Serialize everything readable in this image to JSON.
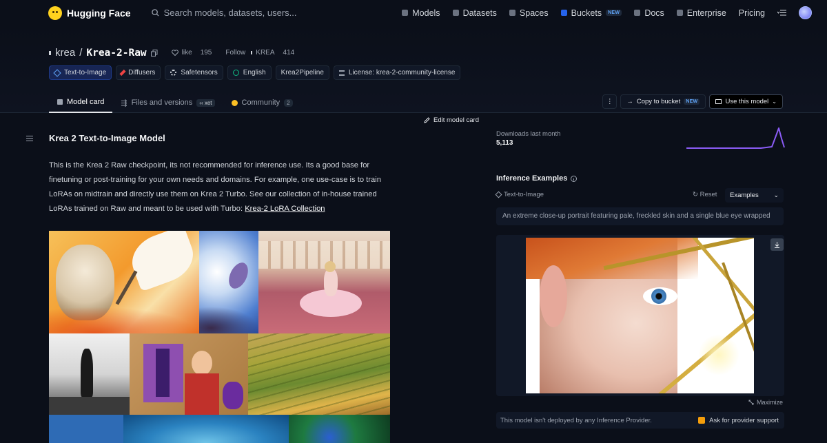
{
  "nav": {
    "brand": "Hugging Face",
    "search_placeholder": "Search models, datasets, users...",
    "links": [
      "Models",
      "Datasets",
      "Spaces",
      "Buckets",
      "Docs",
      "Enterprise",
      "Pricing"
    ],
    "new_badge": "NEW"
  },
  "repo": {
    "org": "krea",
    "sep": "/",
    "name": "Krea-2-Raw",
    "like_label": "like",
    "likes": "195",
    "follow_label": "Follow",
    "follow_org": "KREA",
    "followers": "414"
  },
  "tags": [
    "Text-to-Image",
    "Diffusers",
    "Safetensors",
    "English",
    "Krea2Pipeline",
    "License: krea-2-community-license"
  ],
  "tabs": {
    "model_card": "Model card",
    "files": "Files and versions",
    "xet": "xet",
    "community": "Community",
    "community_count": "2"
  },
  "actions": {
    "copy_bucket": "Copy to bucket",
    "new_badge": "NEW",
    "use_model": "Use this model"
  },
  "card": {
    "edit": "Edit model card",
    "heading": "Krea 2 Text-to-Image Model",
    "paragraph": "This is the Krea 2 Raw checkpoint, its not recommended for inference use. Its a good base for finetuning or post-training for your own needs and domains. For example, one use-case is to train LoRAs on midtrain and directly use them on Krea 2 Turbo. See our collection of in-house trained LoRAs trained on Raw and meant to be used with Turbo: ",
    "link": "Krea-2 LoRA Collection"
  },
  "downloads": {
    "label": "Downloads last month",
    "count": "5,113"
  },
  "inference": {
    "title": "Inference Examples",
    "task": "Text-to-Image",
    "reset": "Reset",
    "examples": "Examples",
    "prompt": "An extreme close-up portrait featuring pale, freckled skin and a single blue eye wrapped",
    "maximize": "Maximize",
    "notice": "This model isn't deployed by any Inference Provider.",
    "ask": "Ask for provider support"
  },
  "colors": {
    "background": "#0b0f19",
    "accent": "#8b5cf6",
    "brand": "#ffd21e"
  }
}
